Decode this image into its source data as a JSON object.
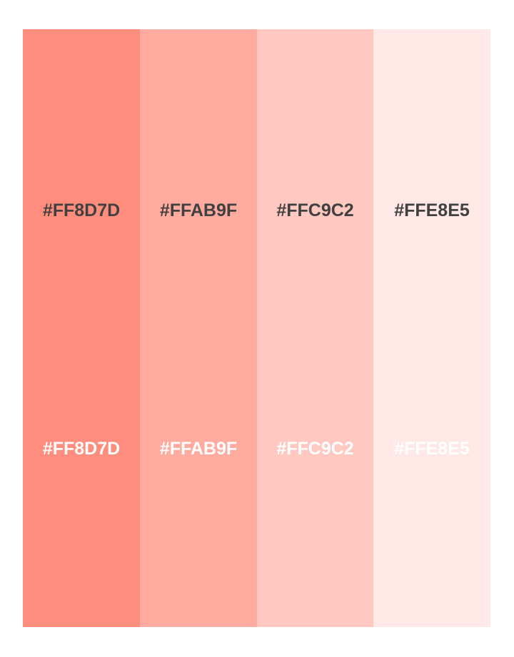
{
  "palette": {
    "swatches": [
      {
        "hex": "#FF8D7D",
        "dark_label": "#FF8D7D",
        "light_label": "#FF8D7D"
      },
      {
        "hex": "#FFAB9F",
        "dark_label": "#FFAB9F",
        "light_label": "#FFAB9F"
      },
      {
        "hex": "#FFC9C2",
        "dark_label": "#FFC9C2",
        "light_label": "#FFC9C2"
      },
      {
        "hex": "#FFE8E5",
        "dark_label": "#FFE8E5",
        "light_label": "#FFE8E5"
      }
    ],
    "dark_text_color": "#404040",
    "light_text_color": "#FFFFFF",
    "background": "#FFFFFF"
  }
}
